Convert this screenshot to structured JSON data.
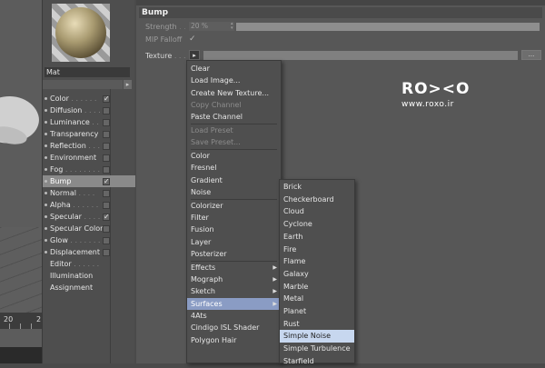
{
  "viewport": {
    "timeline_labels": [
      "20",
      "2"
    ]
  },
  "material": {
    "name": "Mat"
  },
  "channels": [
    {
      "label": "Color",
      "checked": true,
      "dots": " . . . . . ."
    },
    {
      "label": "Diffusion",
      "checked": false,
      "dots": " . . . ."
    },
    {
      "label": "Luminance",
      "checked": false,
      "dots": " . ."
    },
    {
      "label": "Transparency",
      "checked": false,
      "dots": ""
    },
    {
      "label": "Reflection",
      "checked": false,
      "dots": " . . ."
    },
    {
      "label": "Environment",
      "checked": false,
      "dots": ""
    },
    {
      "label": "Fog",
      "checked": false,
      "dots": " . . . . . . . ."
    },
    {
      "label": "Bump",
      "checked": true,
      "dots": "",
      "selected": true
    },
    {
      "label": "Normal",
      "checked": false,
      "dots": " . . . ."
    },
    {
      "label": "Alpha",
      "checked": false,
      "dots": " . . . . . ."
    },
    {
      "label": "Specular",
      "checked": true,
      "dots": " . . . ."
    },
    {
      "label": "Specular Color",
      "checked": false,
      "dots": ""
    },
    {
      "label": "Glow",
      "checked": false,
      "dots": " . . . . . . ."
    },
    {
      "label": "Displacement",
      "checked": false,
      "dots": ""
    },
    {
      "label": "Editor",
      "checked": null,
      "dots": " . . . . . ."
    },
    {
      "label": "Illumination",
      "checked": null,
      "dots": ""
    },
    {
      "label": "Assignment",
      "checked": null,
      "dots": ""
    }
  ],
  "attributes": {
    "title": "Bump",
    "strength_label": "Strength",
    "strength_dots": " . . .",
    "strength_value": "20 %",
    "mip_label": "MIP Falloff",
    "mip_check": "✓",
    "texture_label": "Texture",
    "texture_dots": ". . .",
    "texture_btn": "▸",
    "more_btn": "..."
  },
  "menu": {
    "items": [
      {
        "label": "Clear",
        "disabled": false
      },
      {
        "label": "Load Image...",
        "disabled": false
      },
      {
        "label": "Create New Texture...",
        "disabled": false
      },
      {
        "label": "Copy Channel",
        "disabled": true
      },
      {
        "label": "Paste Channel",
        "disabled": false
      },
      {
        "sep": true
      },
      {
        "label": "Load Preset",
        "disabled": true
      },
      {
        "label": "Save Preset...",
        "disabled": true
      },
      {
        "sep": true
      },
      {
        "label": "Color",
        "disabled": false
      },
      {
        "label": "Fresnel",
        "disabled": false
      },
      {
        "label": "Gradient",
        "disabled": false
      },
      {
        "label": "Noise",
        "disabled": false
      },
      {
        "sep": true
      },
      {
        "label": "Colorizer",
        "disabled": false
      },
      {
        "label": "Filter",
        "disabled": false
      },
      {
        "label": "Fusion",
        "disabled": false
      },
      {
        "label": "Layer",
        "disabled": false
      },
      {
        "label": "Posterizer",
        "disabled": false
      },
      {
        "sep": true
      },
      {
        "label": "Effects",
        "disabled": false,
        "submenu": true
      },
      {
        "label": "Mograph",
        "disabled": false,
        "submenu": true
      },
      {
        "label": "Sketch",
        "disabled": false,
        "submenu": true
      },
      {
        "label": "Surfaces",
        "disabled": false,
        "submenu": true,
        "highlighted": true
      },
      {
        "label": "4Ats",
        "disabled": false
      },
      {
        "label": "Cindigo ISL Shader",
        "disabled": false
      },
      {
        "label": "Polygon Hair",
        "disabled": false
      }
    ]
  },
  "submenu": {
    "items": [
      {
        "label": "Brick"
      },
      {
        "label": "Checkerboard"
      },
      {
        "label": "Cloud"
      },
      {
        "label": "Cyclone"
      },
      {
        "label": "Earth"
      },
      {
        "label": "Fire"
      },
      {
        "label": "Flame"
      },
      {
        "label": "Galaxy"
      },
      {
        "label": "Marble"
      },
      {
        "label": "Metal"
      },
      {
        "label": "Planet"
      },
      {
        "label": "Rust"
      },
      {
        "label": "Simple Noise",
        "highlighted": true
      },
      {
        "label": "Simple Turbulence"
      },
      {
        "label": "Starfield"
      }
    ]
  },
  "watermark": {
    "brand": "RO><O",
    "url": "www.roxo.ir"
  },
  "colors": {
    "menu_highlight": "#8a9cc4",
    "submenu_highlight": "#c7d7ef",
    "selected_channel": "#8a8a8a"
  }
}
